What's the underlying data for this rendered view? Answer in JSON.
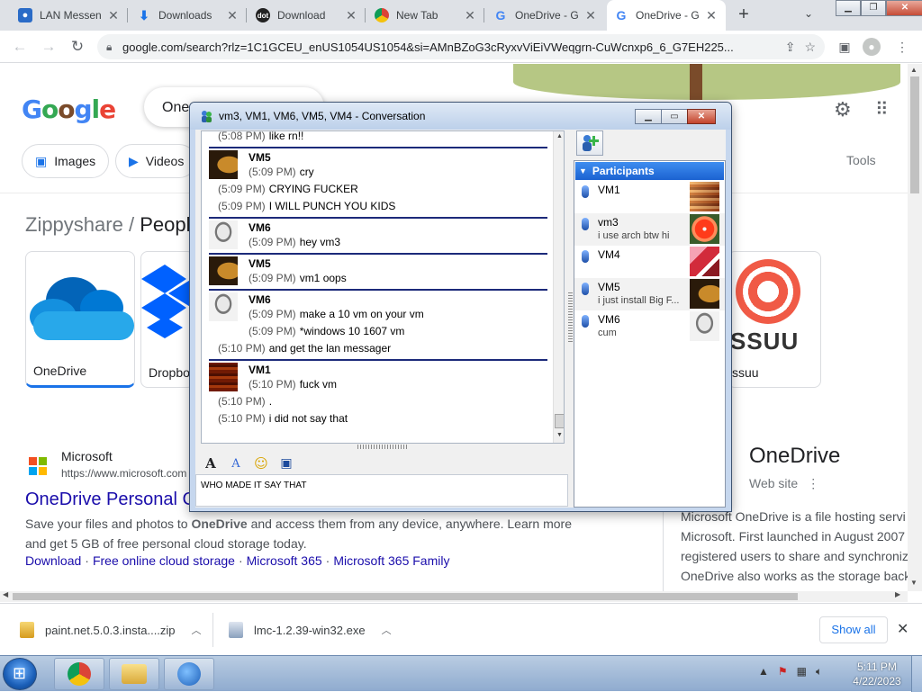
{
  "browser": {
    "tabs": [
      {
        "label": "LAN Messen",
        "icon": "lan-messenger-icon"
      },
      {
        "label": "Downloads",
        "icon": "download-icon"
      },
      {
        "label": "Download",
        "icon": "dot-favicon"
      },
      {
        "label": "New Tab",
        "icon": "chrome-icon"
      },
      {
        "label": "OneDrive - G",
        "icon": "google-icon"
      },
      {
        "label": "OneDrive - G",
        "icon": "google-icon",
        "active": true
      }
    ],
    "url": "google.com/search?rlz=1C1GCEU_enUS1054US1054&si=AMnBZoG3cRyxvViEiVWeqgrn-CuWcnxp6_6_G7EH225...",
    "window_controls": {
      "minimize": "▁",
      "maximize": "❐",
      "close": "✕"
    }
  },
  "google": {
    "logo_letters": [
      "G",
      "o",
      "o",
      "g",
      "l",
      "e"
    ],
    "search_query": "One",
    "chips": [
      {
        "label": "Images",
        "icon": "image-icon"
      },
      {
        "label": "Videos",
        "icon": "video-icon"
      }
    ],
    "tools_label": "Tools",
    "kp_title_site": "Zippyshare",
    "kp_title_slash": " / ",
    "kp_title_rest": "People",
    "cards": [
      {
        "label": "OneDrive"
      },
      {
        "label": "Dropbo"
      },
      {
        "label": "ssuu",
        "logo_text": "SSUU"
      }
    ],
    "result": {
      "site_name": "Microsoft",
      "site_url": "https://www.microsoft.com",
      "title": "OneDrive Personal C",
      "snippet_pre": "Save your files and photos to ",
      "snippet_bold": "OneDrive",
      "snippet_post": " and access them from any device, anywhere. Learn more and get 5 GB of free personal cloud storage today.",
      "links": [
        "Download",
        "Free online cloud storage",
        "Microsoft 365",
        "Microsoft 365 Family"
      ]
    },
    "kp_right": {
      "title": "OneDrive",
      "subtitle": "Web site",
      "desc_lines": [
        "Microsoft OneDrive is a file hosting servi",
        "Microsoft. First launched in August 2007",
        "registered users to share and synchroniz",
        "OneDrive also works as the storage back"
      ]
    }
  },
  "downloads": {
    "items": [
      {
        "name": "paint.net.5.0.3.insta....zip"
      },
      {
        "name": "lmc-1.2.39-win32.exe"
      }
    ],
    "show_all": "Show all"
  },
  "taskbar": {
    "time": "5:11 PM",
    "date": "4/22/2023"
  },
  "conversation": {
    "title": "vm3, VM1, VM6, VM5, VM4 - Conversation",
    "messages": [
      {
        "kind": "cont",
        "time": "(5:08 PM)",
        "text": "like rn!!"
      },
      {
        "kind": "sep"
      },
      {
        "kind": "hdr",
        "sender": "VM5",
        "avatar": "av-vm5",
        "time": "(5:09 PM)",
        "text": "cry"
      },
      {
        "kind": "cont",
        "time": "(5:09 PM)",
        "text": "CRYING FUCKER"
      },
      {
        "kind": "cont",
        "time": "(5:09 PM)",
        "text": "I WILL PUNCH YOU KIDS"
      },
      {
        "kind": "sep"
      },
      {
        "kind": "hdr",
        "sender": "VM6",
        "avatar": "av-vm6",
        "time": "(5:09 PM)",
        "text": "hey vm3"
      },
      {
        "kind": "sep"
      },
      {
        "kind": "hdr",
        "sender": "VM5",
        "avatar": "av-vm5",
        "time": "(5:09 PM)",
        "text": "vm1 oops"
      },
      {
        "kind": "sep"
      },
      {
        "kind": "hdr",
        "sender": "VM6",
        "avatar": "av-vm6",
        "time": "(5:09 PM)",
        "text": "make a 10 vm on your vm"
      },
      {
        "kind": "cont",
        "indent": true,
        "time": "(5:09 PM)",
        "text": "*windows 10 1607 vm"
      },
      {
        "kind": "cont",
        "time": "(5:10 PM)",
        "text": "and get the lan messager"
      },
      {
        "kind": "sep"
      },
      {
        "kind": "hdr",
        "sender": "VM1",
        "avatar": "av-vm1",
        "time": "(5:10 PM)",
        "text": "fuck vm"
      },
      {
        "kind": "cont",
        "time": "(5:10 PM)",
        "text": "."
      },
      {
        "kind": "cont",
        "time": "(5:10 PM)",
        "text": "i did not say that"
      }
    ],
    "input_text": "WHO MADE IT SAY THAT",
    "participants_header": "Participants",
    "participants": [
      {
        "name": "VM1",
        "note": "",
        "avatar": "av-vm1b"
      },
      {
        "name": "vm3",
        "note": "i use arch btw hi",
        "avatar": "av-vm3"
      },
      {
        "name": "VM4",
        "note": "",
        "avatar": "av-vm4"
      },
      {
        "name": "VM5",
        "note": "i just install Big F...",
        "avatar": "av-vm5"
      },
      {
        "name": "VM6",
        "note": "cum",
        "avatar": "av-vm6"
      }
    ]
  }
}
